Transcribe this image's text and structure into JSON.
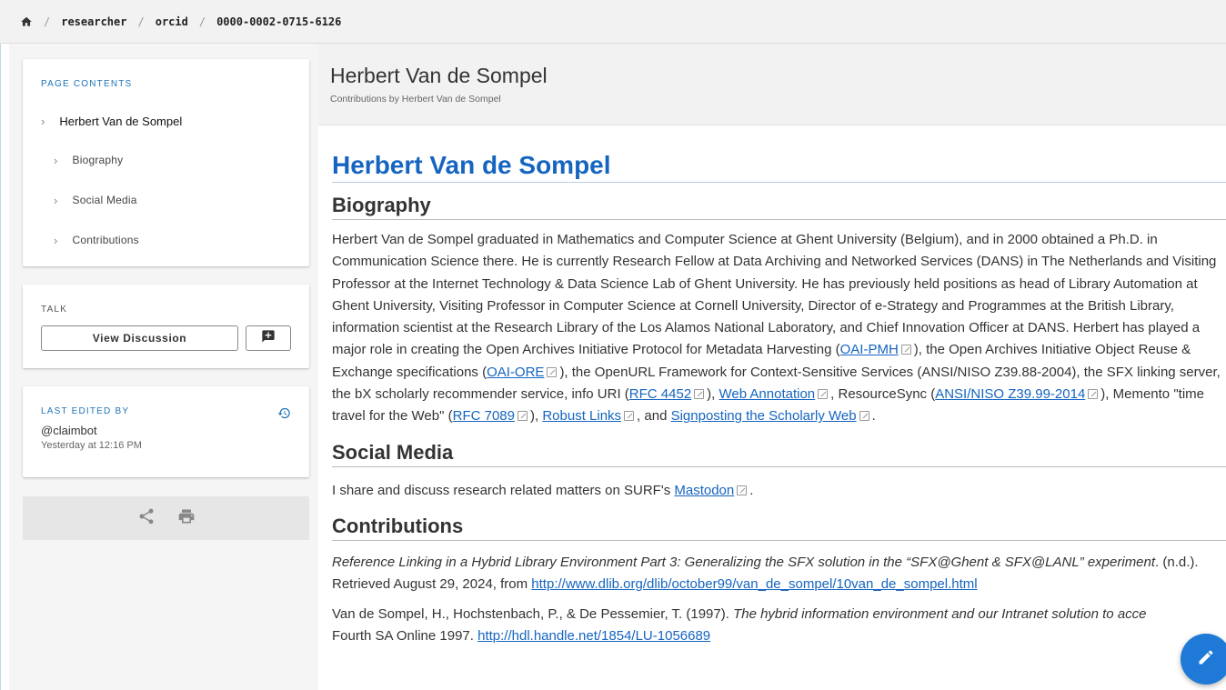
{
  "breadcrumb": {
    "items": [
      "researcher",
      "orcid",
      "0000-0002-0715-6126"
    ],
    "separator": "/"
  },
  "sidebar": {
    "toc": {
      "title": "PAGE CONTENTS",
      "main": "Herbert Van de Sompel",
      "items": [
        "Biography",
        "Social Media",
        "Contributions"
      ]
    },
    "talk": {
      "title": "TALK",
      "view_label": "View Discussion"
    },
    "edited": {
      "title": "LAST EDITED BY",
      "user": "@claimbot",
      "time": "Yesterday at 12:16 PM"
    }
  },
  "header": {
    "title": "Herbert Van de Sompel",
    "subtitle": "Contributions by Herbert Van de Sompel"
  },
  "content": {
    "name": "Herbert Van de Sompel",
    "biography_heading": "Biography",
    "bio": {
      "t1": "Herbert Van de Sompel graduated in Mathematics and Computer Science at Ghent University (Belgium), and in 2000 obtained a Ph.D. in Communication Science there. He is currently Research Fellow at Data Archiving and Networked Services (DANS) in The Netherlands and Visiting Professor at the Internet Technology & Data Science Lab of Ghent University. He has previously held positions as head of Library Automation at Ghent University, Visiting Professor in Computer Science at Cornell University, Director of e-Strategy and Programmes at the British Library, information scientist at the Research Library of the Los Alamos National Laboratory, and Chief Innovation Officer at DANS. Herbert has played a major role in creating the Open Archives Initiative Protocol for Metadata Harvesting (",
      "l1": "OAI-PMH",
      "t2": "), the Open Archives Initiative Object Reuse & Exchange specifications (",
      "l2": "OAI-ORE",
      "t3": "), the OpenURL Framework for Context-Sensitive Services (ANSI/NISO Z39.88-2004), the SFX linking server, the bX scholarly recommender service, info URI (",
      "l3": "RFC 4452",
      "t4": "), ",
      "l4": "Web Annotation",
      "t5": ", ResourceSync (",
      "l5": "ANSI/NISO Z39.99-2014",
      "t6": "), Memento \"time travel for the Web\" (",
      "l6": "RFC 7089",
      "t7": "), ",
      "l7": "Robust Links",
      "t8": ", and ",
      "l8": "Signposting the Scholarly Web",
      "t9": "."
    },
    "social_heading": "Social Media",
    "social": {
      "t1": "I share and discuss research related matters on SURF's ",
      "l1": "Mastodon",
      "t2": "."
    },
    "contributions_heading": "Contributions",
    "refs": [
      {
        "title": "Reference Linking in a Hybrid Library Environment Part 3: Generalizing the SFX solution in the “SFX@Ghent & SFX@LANL” experiment",
        "rest": ". (n.d.).",
        "line2": "Retrieved August 29, 2024, from ",
        "url": "http://www.dlib.org/dlib/october99/van_de_sompel/10van_de_sompel.html"
      },
      {
        "authors": "Van de Sompel, H., Hochstenbach, P., & De Pessemier, T. (1997). ",
        "title": "The hybrid information environment and our Intranet solution to acce",
        "line2": "Fourth SA Online 1997. ",
        "url": "http://hdl.handle.net/1854/LU-1056689"
      }
    ]
  },
  "icons": {
    "home": "home-icon",
    "comment": "add-comment-icon",
    "history": "history-icon",
    "share": "share-icon",
    "print": "print-icon",
    "edit": "pencil-icon"
  },
  "colors": {
    "accent": "#1565c0",
    "fab": "#1e7ad6"
  }
}
